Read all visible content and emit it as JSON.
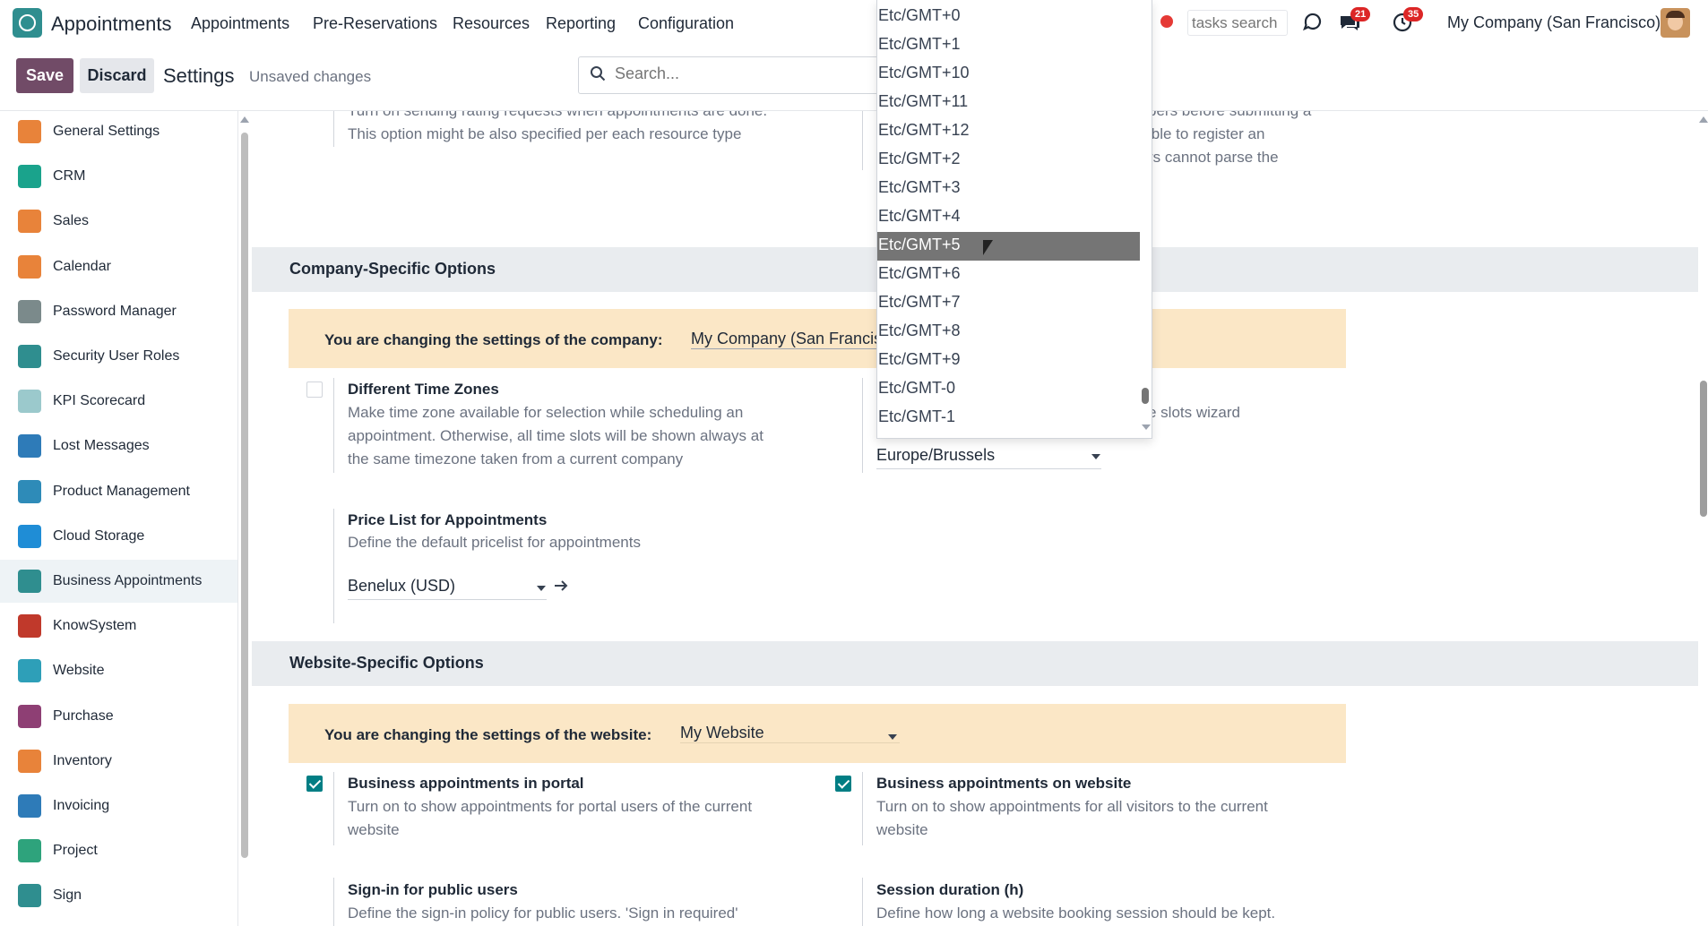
{
  "navbar": {
    "app_name": "Appointments",
    "menu": [
      "Appointments",
      "Pre-Reservations",
      "Resources",
      "Reporting",
      "Configuration"
    ],
    "tasks_search_placeholder": "tasks search",
    "messages_badge": "21",
    "activities_badge": "35",
    "company": "My Company (San Francisco)"
  },
  "control": {
    "save_label": "Save",
    "discard_label": "Discard",
    "title": "Settings",
    "status": "Unsaved changes",
    "search_placeholder": "Search..."
  },
  "sidebar": {
    "items": [
      {
        "label": "General Settings",
        "icon": "general-settings-icon",
        "color": "#e8833a"
      },
      {
        "label": "CRM",
        "icon": "crm-icon",
        "color": "#1aa38c"
      },
      {
        "label": "Sales",
        "icon": "sales-icon",
        "color": "#e8833a"
      },
      {
        "label": "Calendar",
        "icon": "calendar-icon",
        "color": "#e8833a"
      },
      {
        "label": "Password Manager",
        "icon": "password-manager-icon",
        "color": "#7b8a8b"
      },
      {
        "label": "Security User Roles",
        "icon": "security-user-roles-icon",
        "color": "#2f8e8f"
      },
      {
        "label": "KPI Scorecard",
        "icon": "kpi-scorecard-icon",
        "color": "#9bc9cc"
      },
      {
        "label": "Lost Messages",
        "icon": "lost-messages-icon",
        "color": "#2e7bb8"
      },
      {
        "label": "Product Management",
        "icon": "product-management-icon",
        "color": "#2e8bb8"
      },
      {
        "label": "Cloud Storage",
        "icon": "cloud-storage-icon",
        "color": "#1f8dd6"
      },
      {
        "label": "Business Appointments",
        "icon": "business-appointments-icon",
        "color": "#2f8e8f"
      },
      {
        "label": "KnowSystem",
        "icon": "knowsystem-icon",
        "color": "#c0392b"
      },
      {
        "label": "Website",
        "icon": "website-icon",
        "color": "#2e9fb8"
      },
      {
        "label": "Purchase",
        "icon": "purchase-icon",
        "color": "#8e3f74"
      },
      {
        "label": "Inventory",
        "icon": "inventory-icon",
        "color": "#e8833a"
      },
      {
        "label": "Invoicing",
        "icon": "invoicing-icon",
        "color": "#2e7bb8"
      },
      {
        "label": "Project",
        "icon": "project-icon",
        "color": "#2ea37c"
      },
      {
        "label": "Sign",
        "icon": "sign-icon",
        "color": "#2f8e8f"
      }
    ],
    "active_index": 10
  },
  "content": {
    "top_left_text_1": "Turn on sending rating requests when appointments are done.",
    "top_left_text_2": "This option might be also specified per each resource type",
    "top_right_text_1": "bers before submitting a",
    "top_right_text_2": "ible to register an",
    "top_right_text_3": "rs cannot parse the",
    "company_section_title": "Company-Specific Options",
    "company_banner_label": "You are changing the settings of the company:",
    "company_banner_value": "My Company (San Francisco)",
    "tz_title": "Different Time Zones",
    "tz_desc_1": "Make time zone available for selection while scheduling an",
    "tz_desc_2": "appointment. Otherwise, all time slots will be shown always at",
    "tz_desc_3": "the same timezone taken from a current company",
    "tz_checked": false,
    "right_partial_text": "e slots wizard",
    "tz_select_value": "Europe/Brussels",
    "pricelist_title": "Price List for Appointments",
    "pricelist_desc": "Define the default pricelist for appointments",
    "pricelist_value": "Benelux (USD)",
    "website_section_title": "Website-Specific Options",
    "website_banner_label": "You are changing the settings of the website:",
    "website_banner_value": "My Website",
    "portal_title": "Business appointments in portal",
    "portal_desc_1": "Turn on to show appointments for portal users of the current",
    "portal_desc_2": "website",
    "portal_checked": true,
    "website_title": "Business appointments on website",
    "website_desc_1": "Turn on to show appointments for all visitors to the current",
    "website_desc_2": "website",
    "website_checked": true,
    "signin_title": "Sign-in for public users",
    "signin_desc": "Define the sign-in policy for public users. 'Sign in required'",
    "session_title": "Session duration (h)",
    "session_desc": "Define how long a website booking session should be kept."
  },
  "timezone_dropdown": {
    "options": [
      "Etc/GMT+0",
      "Etc/GMT+1",
      "Etc/GMT+10",
      "Etc/GMT+11",
      "Etc/GMT+12",
      "Etc/GMT+2",
      "Etc/GMT+3",
      "Etc/GMT+4",
      "Etc/GMT+5",
      "Etc/GMT+6",
      "Etc/GMT+7",
      "Etc/GMT+8",
      "Etc/GMT+9",
      "Etc/GMT-0",
      "Etc/GMT-1"
    ],
    "highlighted_index": 8
  },
  "colors": {
    "brand": "#714b67",
    "accent": "#017e84",
    "banner": "#fbe7c6",
    "section": "#e9ecef"
  }
}
